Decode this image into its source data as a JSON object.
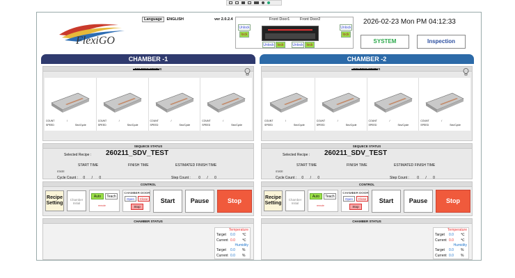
{
  "header": {
    "logo_text": "FlexiGO",
    "language_label": "Language",
    "language_value": "ENGLISH",
    "version": "ver 2.0.2.4",
    "front_door1": "Front Door1",
    "front_door2": "Front Door2",
    "unlock": "Unlock",
    "lock": "lock",
    "datetime": "2026-02-23 Mon PM 04:12:33",
    "system_button": "SYSTEM",
    "inspection_button": "Inspection"
  },
  "chambers": [
    {
      "title": "CHAMBER -1",
      "color": "#2f3a6e",
      "folding_status": "FOLDING STATUS",
      "count_label": "COUNT",
      "count_slash": "/",
      "speed_label": "SPEED",
      "sec_cycle": "Sec/Cycle",
      "sequence_status": "SEQUECE STATUS",
      "selected_recipe_label": "Selected Recipe :",
      "selected_recipe_value": "260211_SDV_TEST",
      "start_time": "START TIME",
      "finish_time": "FINISH TIME",
      "estimated_finish_time": "ESTIMATED FINISH TIME",
      "state": "STATE",
      "cycle_count_label": "Cycle Count :",
      "cycle_count": "0",
      "cycle_total": "0",
      "step_count_label": "Step Count :",
      "step_count": "0",
      "step_total": "0",
      "control": "CONTROL",
      "recipe_setting": "Recipe Setting",
      "chamber_initial": "Chamber Initial",
      "auto": "Auto",
      "teach": "Teach",
      "interlock": "remote",
      "chamber_door": "CHAMBER DOOR",
      "open": "Open",
      "close": "Close",
      "stop_small": "Stop",
      "start": "Start",
      "pause": "Pause",
      "stop": "Stop",
      "chamber_status": "CHAMBER STATUS",
      "temperature": "Temperature",
      "humidity": "Humidity",
      "target": "Target",
      "current": "Current",
      "temp_target": "0.0",
      "temp_current": "0.0",
      "temp_unit": "℃",
      "hum_target": "0.0",
      "hum_current": "0.0",
      "hum_unit": "%"
    },
    {
      "title": "CHAMBER -2",
      "color": "#2c6aa8",
      "folding_status": "FOLDING STATUS",
      "count_label": "COUNT",
      "count_slash": "/",
      "speed_label": "SPEED",
      "sec_cycle": "Sec/Cycle",
      "sequence_status": "SEQUECE STATUS",
      "selected_recipe_label": "Selected Recipe :",
      "selected_recipe_value": "260211_SDV_TEST",
      "start_time": "START TIME",
      "finish_time": "FINISH TIME",
      "estimated_finish_time": "ESTIMATED FINISH TIME",
      "state": "STATE",
      "cycle_count_label": "Cycle Count :",
      "cycle_count": "0",
      "cycle_total": "0",
      "step_count_label": "Step Count :",
      "step_count": "0",
      "step_total": "0",
      "control": "CONTROL",
      "recipe_setting": "Recipe Setting",
      "chamber_initial": "Chamber Initial",
      "auto": "Auto",
      "teach": "Teach",
      "interlock": "remote",
      "chamber_door": "CHAMBER DOOR",
      "open": "Open",
      "close": "Close",
      "stop_small": "Stop",
      "start": "Start",
      "pause": "Pause",
      "stop": "Stop",
      "chamber_status": "CHAMBER STATUS",
      "temperature": "Temperature",
      "humidity": "Humidity",
      "target": "Target",
      "current": "Current",
      "temp_target": "0.0",
      "temp_current": "0.0",
      "temp_unit": "℃",
      "hum_target": "0.0",
      "hum_current": "0.0",
      "hum_unit": "%"
    }
  ],
  "colors": {
    "stop_button": "#f05a3c",
    "auto_active": "#9ce048",
    "lock_green": "#9ce048",
    "system_text": "#2aa84a",
    "inspection_text": "#2c4fa0",
    "tower_yellow": "#f6f25a"
  },
  "icons": {
    "lamp": "lightbulb-icon",
    "tower_lamp": "tower-lamp-icon"
  }
}
